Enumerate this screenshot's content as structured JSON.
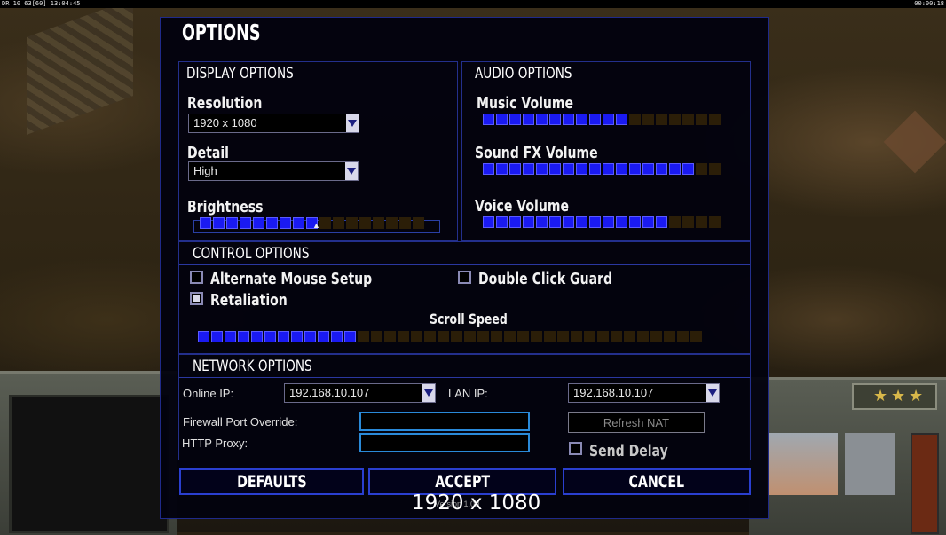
{
  "hud": {
    "stats": "DR 10 63[60] 13:04:45",
    "timer": "00:00:18"
  },
  "title": "OPTIONS",
  "display": {
    "header": "DISPLAY OPTIONS",
    "resolution_label": "Resolution",
    "resolution_value": "1920 x 1080",
    "detail_label": "Detail",
    "detail_value": "High",
    "brightness_label": "Brightness",
    "brightness_level": 9,
    "brightness_max": 17
  },
  "audio": {
    "header": "AUDIO OPTIONS",
    "music_label": "Music Volume",
    "music_level": 11,
    "sfx_label": "Sound FX Volume",
    "sfx_level": 16,
    "voice_label": "Voice Volume",
    "voice_level": 14,
    "max": 18
  },
  "control": {
    "header": "CONTROL OPTIONS",
    "alt_mouse_label": "Alternate Mouse Setup",
    "alt_mouse_checked": false,
    "double_click_label": "Double Click Guard",
    "double_click_checked": false,
    "retaliation_label": "Retaliation",
    "retaliation_checked": true,
    "scroll_label": "Scroll Speed",
    "scroll_level": 12,
    "scroll_max": 38
  },
  "network": {
    "header": "NETWORK OPTIONS",
    "online_ip_label": "Online IP:",
    "online_ip_value": "192.168.10.107",
    "lan_ip_label": "LAN IP:",
    "lan_ip_value": "192.168.10.107",
    "firewall_label": "Firewall Port Override:",
    "firewall_value": "",
    "proxy_label": "HTTP Proxy:",
    "proxy_value": "",
    "refresh_nat_label": "Refresh NAT",
    "send_delay_label": "Send Delay",
    "send_delay_checked": false
  },
  "buttons": {
    "defaults": "DEFAULTS",
    "accept": "ACCEPT",
    "cancel": "CANCEL"
  },
  "version": "Version 1.00",
  "resolution_overlay": "1920 x 1080",
  "colors": {
    "panel_border": "#1f2a8a",
    "slider_on": "#1a1af2",
    "slider_off": "#2b1e08",
    "input_border": "#2a8ad8"
  }
}
